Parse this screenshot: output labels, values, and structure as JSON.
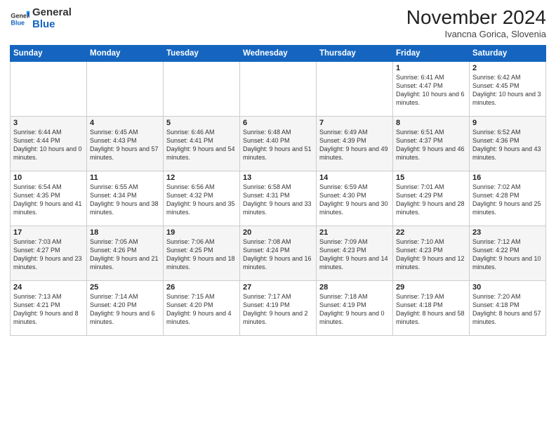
{
  "header": {
    "logo": {
      "general": "General",
      "blue": "Blue"
    },
    "title": "November 2024",
    "subtitle": "Ivancna Gorica, Slovenia"
  },
  "days_of_week": [
    "Sunday",
    "Monday",
    "Tuesday",
    "Wednesday",
    "Thursday",
    "Friday",
    "Saturday"
  ],
  "weeks": [
    [
      {
        "num": "",
        "info": ""
      },
      {
        "num": "",
        "info": ""
      },
      {
        "num": "",
        "info": ""
      },
      {
        "num": "",
        "info": ""
      },
      {
        "num": "",
        "info": ""
      },
      {
        "num": "1",
        "info": "Sunrise: 6:41 AM\nSunset: 4:47 PM\nDaylight: 10 hours\nand 6 minutes."
      },
      {
        "num": "2",
        "info": "Sunrise: 6:42 AM\nSunset: 4:45 PM\nDaylight: 10 hours\nand 3 minutes."
      }
    ],
    [
      {
        "num": "3",
        "info": "Sunrise: 6:44 AM\nSunset: 4:44 PM\nDaylight: 10 hours\nand 0 minutes."
      },
      {
        "num": "4",
        "info": "Sunrise: 6:45 AM\nSunset: 4:43 PM\nDaylight: 9 hours\nand 57 minutes."
      },
      {
        "num": "5",
        "info": "Sunrise: 6:46 AM\nSunset: 4:41 PM\nDaylight: 9 hours\nand 54 minutes."
      },
      {
        "num": "6",
        "info": "Sunrise: 6:48 AM\nSunset: 4:40 PM\nDaylight: 9 hours\nand 51 minutes."
      },
      {
        "num": "7",
        "info": "Sunrise: 6:49 AM\nSunset: 4:39 PM\nDaylight: 9 hours\nand 49 minutes."
      },
      {
        "num": "8",
        "info": "Sunrise: 6:51 AM\nSunset: 4:37 PM\nDaylight: 9 hours\nand 46 minutes."
      },
      {
        "num": "9",
        "info": "Sunrise: 6:52 AM\nSunset: 4:36 PM\nDaylight: 9 hours\nand 43 minutes."
      }
    ],
    [
      {
        "num": "10",
        "info": "Sunrise: 6:54 AM\nSunset: 4:35 PM\nDaylight: 9 hours\nand 41 minutes."
      },
      {
        "num": "11",
        "info": "Sunrise: 6:55 AM\nSunset: 4:34 PM\nDaylight: 9 hours\nand 38 minutes."
      },
      {
        "num": "12",
        "info": "Sunrise: 6:56 AM\nSunset: 4:32 PM\nDaylight: 9 hours\nand 35 minutes."
      },
      {
        "num": "13",
        "info": "Sunrise: 6:58 AM\nSunset: 4:31 PM\nDaylight: 9 hours\nand 33 minutes."
      },
      {
        "num": "14",
        "info": "Sunrise: 6:59 AM\nSunset: 4:30 PM\nDaylight: 9 hours\nand 30 minutes."
      },
      {
        "num": "15",
        "info": "Sunrise: 7:01 AM\nSunset: 4:29 PM\nDaylight: 9 hours\nand 28 minutes."
      },
      {
        "num": "16",
        "info": "Sunrise: 7:02 AM\nSunset: 4:28 PM\nDaylight: 9 hours\nand 25 minutes."
      }
    ],
    [
      {
        "num": "17",
        "info": "Sunrise: 7:03 AM\nSunset: 4:27 PM\nDaylight: 9 hours\nand 23 minutes."
      },
      {
        "num": "18",
        "info": "Sunrise: 7:05 AM\nSunset: 4:26 PM\nDaylight: 9 hours\nand 21 minutes."
      },
      {
        "num": "19",
        "info": "Sunrise: 7:06 AM\nSunset: 4:25 PM\nDaylight: 9 hours\nand 18 minutes."
      },
      {
        "num": "20",
        "info": "Sunrise: 7:08 AM\nSunset: 4:24 PM\nDaylight: 9 hours\nand 16 minutes."
      },
      {
        "num": "21",
        "info": "Sunrise: 7:09 AM\nSunset: 4:23 PM\nDaylight: 9 hours\nand 14 minutes."
      },
      {
        "num": "22",
        "info": "Sunrise: 7:10 AM\nSunset: 4:23 PM\nDaylight: 9 hours\nand 12 minutes."
      },
      {
        "num": "23",
        "info": "Sunrise: 7:12 AM\nSunset: 4:22 PM\nDaylight: 9 hours\nand 10 minutes."
      }
    ],
    [
      {
        "num": "24",
        "info": "Sunrise: 7:13 AM\nSunset: 4:21 PM\nDaylight: 9 hours\nand 8 minutes."
      },
      {
        "num": "25",
        "info": "Sunrise: 7:14 AM\nSunset: 4:20 PM\nDaylight: 9 hours\nand 6 minutes."
      },
      {
        "num": "26",
        "info": "Sunrise: 7:15 AM\nSunset: 4:20 PM\nDaylight: 9 hours\nand 4 minutes."
      },
      {
        "num": "27",
        "info": "Sunrise: 7:17 AM\nSunset: 4:19 PM\nDaylight: 9 hours\nand 2 minutes."
      },
      {
        "num": "28",
        "info": "Sunrise: 7:18 AM\nSunset: 4:19 PM\nDaylight: 9 hours\nand 0 minutes."
      },
      {
        "num": "29",
        "info": "Sunrise: 7:19 AM\nSunset: 4:18 PM\nDaylight: 8 hours\nand 58 minutes."
      },
      {
        "num": "30",
        "info": "Sunrise: 7:20 AM\nSunset: 4:18 PM\nDaylight: 8 hours\nand 57 minutes."
      }
    ]
  ]
}
